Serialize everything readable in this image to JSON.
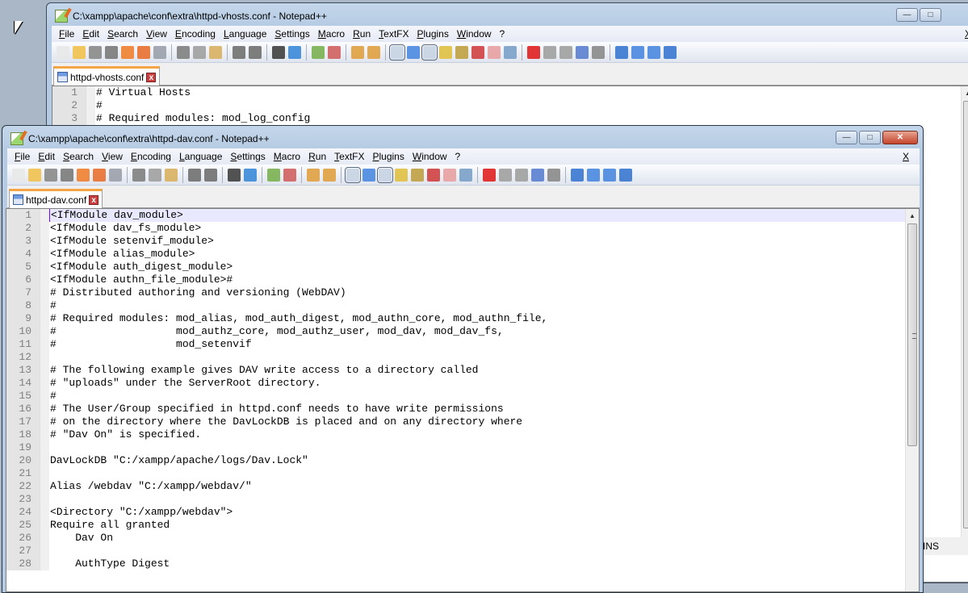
{
  "back_window": {
    "title": "C:\\xampp\\apache\\conf\\extra\\httpd-vhosts.conf - Notepad++",
    "tab": "httpd-vhosts.conf",
    "lines": [
      {
        "n": "1",
        "t": "# Virtual Hosts"
      },
      {
        "n": "2",
        "t": "#"
      },
      {
        "n": "3",
        "t": "# Required modules: mod_log_config"
      }
    ],
    "status_mode": "INS"
  },
  "front_window": {
    "title": "C:\\xampp\\apache\\conf\\extra\\httpd-dav.conf - Notepad++",
    "tab": "httpd-dav.conf",
    "lines": [
      {
        "n": "1",
        "t": "<IfModule dav_module>"
      },
      {
        "n": "2",
        "t": "<IfModule dav_fs_module>"
      },
      {
        "n": "3",
        "t": "<IfModule setenvif_module>"
      },
      {
        "n": "4",
        "t": "<IfModule alias_module>"
      },
      {
        "n": "5",
        "t": "<IfModule auth_digest_module>"
      },
      {
        "n": "6",
        "t": "<IfModule authn_file_module>#"
      },
      {
        "n": "7",
        "t": "# Distributed authoring and versioning (WebDAV)"
      },
      {
        "n": "8",
        "t": "#"
      },
      {
        "n": "9",
        "t": "# Required modules: mod_alias, mod_auth_digest, mod_authn_core, mod_authn_file,"
      },
      {
        "n": "10",
        "t": "#                   mod_authz_core, mod_authz_user, mod_dav, mod_dav_fs,"
      },
      {
        "n": "11",
        "t": "#                   mod_setenvif"
      },
      {
        "n": "12",
        "t": ""
      },
      {
        "n": "13",
        "t": "# The following example gives DAV write access to a directory called"
      },
      {
        "n": "14",
        "t": "# \"uploads\" under the ServerRoot directory."
      },
      {
        "n": "15",
        "t": "#"
      },
      {
        "n": "16",
        "t": "# The User/Group specified in httpd.conf needs to have write permissions"
      },
      {
        "n": "17",
        "t": "# on the directory where the DavLockDB is placed and on any directory where"
      },
      {
        "n": "18",
        "t": "# \"Dav On\" is specified."
      },
      {
        "n": "19",
        "t": ""
      },
      {
        "n": "20",
        "t": "DavLockDB \"C:/xampp/apache/logs/Dav.Lock\""
      },
      {
        "n": "21",
        "t": ""
      },
      {
        "n": "22",
        "t": "Alias /webdav \"C:/xampp/webdav/\""
      },
      {
        "n": "23",
        "t": ""
      },
      {
        "n": "24",
        "t": "<Directory \"C:/xampp/webdav\">"
      },
      {
        "n": "25",
        "t": "Require all granted"
      },
      {
        "n": "26",
        "t": "    Dav On"
      },
      {
        "n": "27",
        "t": ""
      },
      {
        "n": "28",
        "t": "    AuthType Digest"
      }
    ]
  },
  "menu": [
    "File",
    "Edit",
    "Search",
    "View",
    "Encoding",
    "Language",
    "Settings",
    "Macro",
    "Run",
    "TextFX",
    "Plugins",
    "Window",
    "?"
  ],
  "menu_close": "X",
  "window_controls": {
    "minimize": "—",
    "maximize": "□",
    "close": "✕"
  },
  "tab_close": "x",
  "toolbar": [
    {
      "icon": "new-file-icon",
      "color": "#e8e8e8"
    },
    {
      "icon": "open-file-icon",
      "color": "#f2c14e"
    },
    {
      "icon": "save-icon",
      "color": "#8a8a8a"
    },
    {
      "icon": "save-all-icon",
      "color": "#7a7a7a"
    },
    {
      "icon": "close-icon",
      "color": "#f08030"
    },
    {
      "icon": "close-all-icon",
      "color": "#e87030"
    },
    {
      "icon": "print-icon",
      "color": "#9aa0aa"
    },
    {
      "icon": "sep"
    },
    {
      "icon": "cut-icon",
      "color": "#808080"
    },
    {
      "icon": "copy-icon",
      "color": "#a0a0a0"
    },
    {
      "icon": "paste-icon",
      "color": "#d8b060"
    },
    {
      "icon": "sep"
    },
    {
      "icon": "undo-icon",
      "color": "#707070"
    },
    {
      "icon": "redo-icon",
      "color": "#707070"
    },
    {
      "icon": "sep"
    },
    {
      "icon": "find-icon",
      "color": "#404040"
    },
    {
      "icon": "replace-icon",
      "color": "#3a8ad8"
    },
    {
      "icon": "sep"
    },
    {
      "icon": "zoom-in-icon",
      "color": "#7ab050"
    },
    {
      "icon": "zoom-out-icon",
      "color": "#d06060"
    },
    {
      "icon": "sep"
    },
    {
      "icon": "sync-vertical-icon",
      "color": "#e0a040"
    },
    {
      "icon": "sync-horizontal-icon",
      "color": "#e0a040"
    },
    {
      "icon": "sep"
    },
    {
      "icon": "word-wrap-icon",
      "color": "#5a7aa8",
      "sel": true
    },
    {
      "icon": "show-all-chars-icon",
      "color": "#4a8ae0"
    },
    {
      "icon": "indent-guide-icon",
      "color": "#3040c0",
      "sel": true
    },
    {
      "icon": "udl-icon",
      "color": "#e0c040"
    },
    {
      "icon": "doc-map-icon",
      "color": "#c0a040"
    },
    {
      "icon": "function-list-icon",
      "color": "#d04040"
    },
    {
      "icon": "folder-icon",
      "color": "#e8a0a0"
    },
    {
      "icon": "monitor-icon",
      "color": "#7aa0c8"
    },
    {
      "icon": "sep"
    },
    {
      "icon": "record-macro-icon",
      "color": "#e02020"
    },
    {
      "icon": "stop-macro-icon",
      "color": "#a0a0a0"
    },
    {
      "icon": "play-macro-icon",
      "color": "#a0a0a0"
    },
    {
      "icon": "run-macro-multiple-icon",
      "color": "#5a80d0"
    },
    {
      "icon": "save-macro-icon",
      "color": "#8a8a8a"
    },
    {
      "icon": "sep"
    },
    {
      "icon": "first-icon",
      "color": "#3a78d0"
    },
    {
      "icon": "up-icon",
      "color": "#4a88e0"
    },
    {
      "icon": "down-icon",
      "color": "#4a88e0"
    },
    {
      "icon": "last-icon",
      "color": "#3a78d0"
    }
  ]
}
